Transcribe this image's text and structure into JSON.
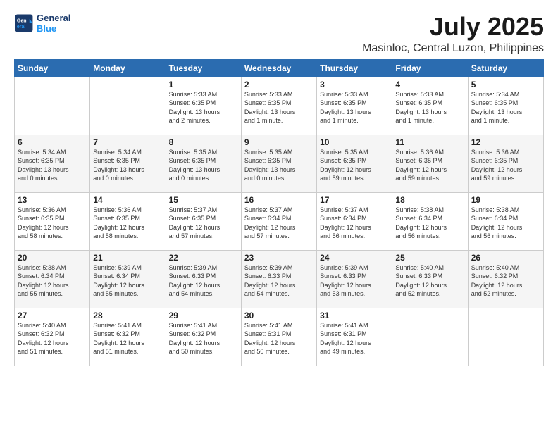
{
  "logo": {
    "line1": "General",
    "line2": "Blue"
  },
  "title": "July 2025",
  "subtitle": "Masinloc, Central Luzon, Philippines",
  "weekdays": [
    "Sunday",
    "Monday",
    "Tuesday",
    "Wednesday",
    "Thursday",
    "Friday",
    "Saturday"
  ],
  "weeks": [
    [
      {
        "day": "",
        "info": ""
      },
      {
        "day": "",
        "info": ""
      },
      {
        "day": "1",
        "info": "Sunrise: 5:33 AM\nSunset: 6:35 PM\nDaylight: 13 hours\nand 2 minutes."
      },
      {
        "day": "2",
        "info": "Sunrise: 5:33 AM\nSunset: 6:35 PM\nDaylight: 13 hours\nand 1 minute."
      },
      {
        "day": "3",
        "info": "Sunrise: 5:33 AM\nSunset: 6:35 PM\nDaylight: 13 hours\nand 1 minute."
      },
      {
        "day": "4",
        "info": "Sunrise: 5:33 AM\nSunset: 6:35 PM\nDaylight: 13 hours\nand 1 minute."
      },
      {
        "day": "5",
        "info": "Sunrise: 5:34 AM\nSunset: 6:35 PM\nDaylight: 13 hours\nand 1 minute."
      }
    ],
    [
      {
        "day": "6",
        "info": "Sunrise: 5:34 AM\nSunset: 6:35 PM\nDaylight: 13 hours\nand 0 minutes."
      },
      {
        "day": "7",
        "info": "Sunrise: 5:34 AM\nSunset: 6:35 PM\nDaylight: 13 hours\nand 0 minutes."
      },
      {
        "day": "8",
        "info": "Sunrise: 5:35 AM\nSunset: 6:35 PM\nDaylight: 13 hours\nand 0 minutes."
      },
      {
        "day": "9",
        "info": "Sunrise: 5:35 AM\nSunset: 6:35 PM\nDaylight: 13 hours\nand 0 minutes."
      },
      {
        "day": "10",
        "info": "Sunrise: 5:35 AM\nSunset: 6:35 PM\nDaylight: 12 hours\nand 59 minutes."
      },
      {
        "day": "11",
        "info": "Sunrise: 5:36 AM\nSunset: 6:35 PM\nDaylight: 12 hours\nand 59 minutes."
      },
      {
        "day": "12",
        "info": "Sunrise: 5:36 AM\nSunset: 6:35 PM\nDaylight: 12 hours\nand 59 minutes."
      }
    ],
    [
      {
        "day": "13",
        "info": "Sunrise: 5:36 AM\nSunset: 6:35 PM\nDaylight: 12 hours\nand 58 minutes."
      },
      {
        "day": "14",
        "info": "Sunrise: 5:36 AM\nSunset: 6:35 PM\nDaylight: 12 hours\nand 58 minutes."
      },
      {
        "day": "15",
        "info": "Sunrise: 5:37 AM\nSunset: 6:35 PM\nDaylight: 12 hours\nand 57 minutes."
      },
      {
        "day": "16",
        "info": "Sunrise: 5:37 AM\nSunset: 6:34 PM\nDaylight: 12 hours\nand 57 minutes."
      },
      {
        "day": "17",
        "info": "Sunrise: 5:37 AM\nSunset: 6:34 PM\nDaylight: 12 hours\nand 56 minutes."
      },
      {
        "day": "18",
        "info": "Sunrise: 5:38 AM\nSunset: 6:34 PM\nDaylight: 12 hours\nand 56 minutes."
      },
      {
        "day": "19",
        "info": "Sunrise: 5:38 AM\nSunset: 6:34 PM\nDaylight: 12 hours\nand 56 minutes."
      }
    ],
    [
      {
        "day": "20",
        "info": "Sunrise: 5:38 AM\nSunset: 6:34 PM\nDaylight: 12 hours\nand 55 minutes."
      },
      {
        "day": "21",
        "info": "Sunrise: 5:39 AM\nSunset: 6:34 PM\nDaylight: 12 hours\nand 55 minutes."
      },
      {
        "day": "22",
        "info": "Sunrise: 5:39 AM\nSunset: 6:33 PM\nDaylight: 12 hours\nand 54 minutes."
      },
      {
        "day": "23",
        "info": "Sunrise: 5:39 AM\nSunset: 6:33 PM\nDaylight: 12 hours\nand 54 minutes."
      },
      {
        "day": "24",
        "info": "Sunrise: 5:39 AM\nSunset: 6:33 PM\nDaylight: 12 hours\nand 53 minutes."
      },
      {
        "day": "25",
        "info": "Sunrise: 5:40 AM\nSunset: 6:33 PM\nDaylight: 12 hours\nand 52 minutes."
      },
      {
        "day": "26",
        "info": "Sunrise: 5:40 AM\nSunset: 6:32 PM\nDaylight: 12 hours\nand 52 minutes."
      }
    ],
    [
      {
        "day": "27",
        "info": "Sunrise: 5:40 AM\nSunset: 6:32 PM\nDaylight: 12 hours\nand 51 minutes."
      },
      {
        "day": "28",
        "info": "Sunrise: 5:41 AM\nSunset: 6:32 PM\nDaylight: 12 hours\nand 51 minutes."
      },
      {
        "day": "29",
        "info": "Sunrise: 5:41 AM\nSunset: 6:32 PM\nDaylight: 12 hours\nand 50 minutes."
      },
      {
        "day": "30",
        "info": "Sunrise: 5:41 AM\nSunset: 6:31 PM\nDaylight: 12 hours\nand 50 minutes."
      },
      {
        "day": "31",
        "info": "Sunrise: 5:41 AM\nSunset: 6:31 PM\nDaylight: 12 hours\nand 49 minutes."
      },
      {
        "day": "",
        "info": ""
      },
      {
        "day": "",
        "info": ""
      }
    ]
  ]
}
